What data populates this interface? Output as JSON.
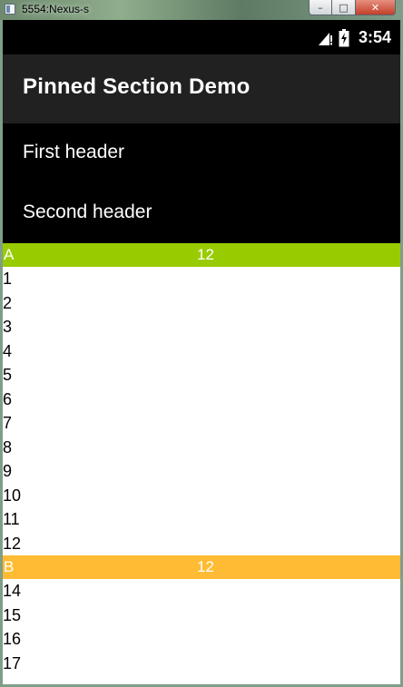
{
  "window": {
    "title": "5554:Nexus-s",
    "minimize": "–",
    "maximize": "□",
    "close": "✕"
  },
  "status_bar": {
    "time": "3:54",
    "icons": [
      "signal-icon",
      "battery-charging-icon"
    ]
  },
  "action_bar": {
    "title": "Pinned Section Demo"
  },
  "headers": [
    "First header",
    "Second header"
  ],
  "sections": [
    {
      "letter": "A",
      "count": "12",
      "color": "#99cc00",
      "items": [
        "1",
        "2",
        "3",
        "4",
        "5",
        "6",
        "7",
        "8",
        "9",
        "10",
        "11",
        "12"
      ]
    },
    {
      "letter": "B",
      "count": "12",
      "color": "#ffbb33",
      "items": [
        "14",
        "15",
        "16",
        "17"
      ]
    }
  ]
}
